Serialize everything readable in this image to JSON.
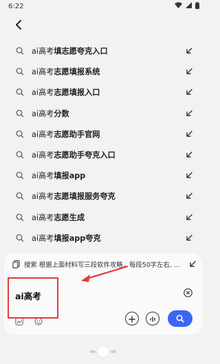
{
  "status_bar": {
    "time": "6:22"
  },
  "suggestions": [
    {
      "prefix": "ai高考",
      "suffix": "填志愿夸克入口"
    },
    {
      "prefix": "ai高考",
      "suffix": "志愿填报系统"
    },
    {
      "prefix": "ai高考",
      "suffix": "志愿填报入口"
    },
    {
      "prefix": "ai高考",
      "suffix": "分数"
    },
    {
      "prefix": "ai高考",
      "suffix": "志愿助手官网"
    },
    {
      "prefix": "ai高考",
      "suffix": "志愿助手夸克入口"
    },
    {
      "prefix": "ai高考",
      "suffix": "填报app"
    },
    {
      "prefix": "ai高考",
      "suffix": "志愿填报服务夸克"
    },
    {
      "prefix": "ai高考",
      "suffix": "志愿生成"
    },
    {
      "prefix": "ai高考",
      "suffix": "填报app夸克"
    }
  ],
  "panel": {
    "chip_text": "搜索 根据上面材料写三段软件攻略，每段50字左右, ...",
    "query": "ai高考"
  },
  "colors": {
    "accent": "#3a66f5",
    "annotation": "#e53935"
  }
}
